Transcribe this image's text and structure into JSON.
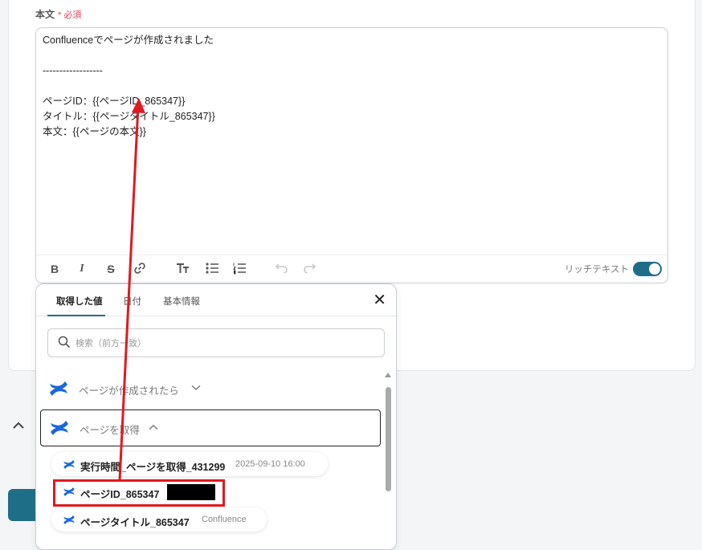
{
  "field": {
    "label": "本文",
    "required": "* 必須"
  },
  "editor": {
    "lines": [
      "Confluenceでページが作成されました",
      "",
      "------------------",
      "",
      "ページID：{{ページID_865347}}",
      "タイトル：{{ページタイトル_865347}}",
      "本文：{{ページの本文}}"
    ],
    "toolbar": {
      "bold": "B",
      "italic": "I",
      "strike": "S",
      "rich_text_label": "リッチテキスト"
    }
  },
  "popup": {
    "tabs": [
      "取得した値",
      "日付",
      "基本情報"
    ],
    "search": {
      "placeholder": "検索（前方一致）"
    },
    "groups": [
      {
        "label": "ページが作成されたら"
      },
      {
        "label": "ページを取得"
      }
    ],
    "items": [
      {
        "name": "実行時間_ページを取得_431299",
        "meta": "2025-09-10 16:00"
      },
      {
        "name": "ページID_865347",
        "meta": ""
      },
      {
        "name": "ページタイトル_865347",
        "meta": "Confluence"
      }
    ]
  },
  "colors": {
    "accent": "#1f6e87",
    "required": "#e0465a",
    "annotation": "#e3181e",
    "confluence_blue": "#1868db"
  }
}
